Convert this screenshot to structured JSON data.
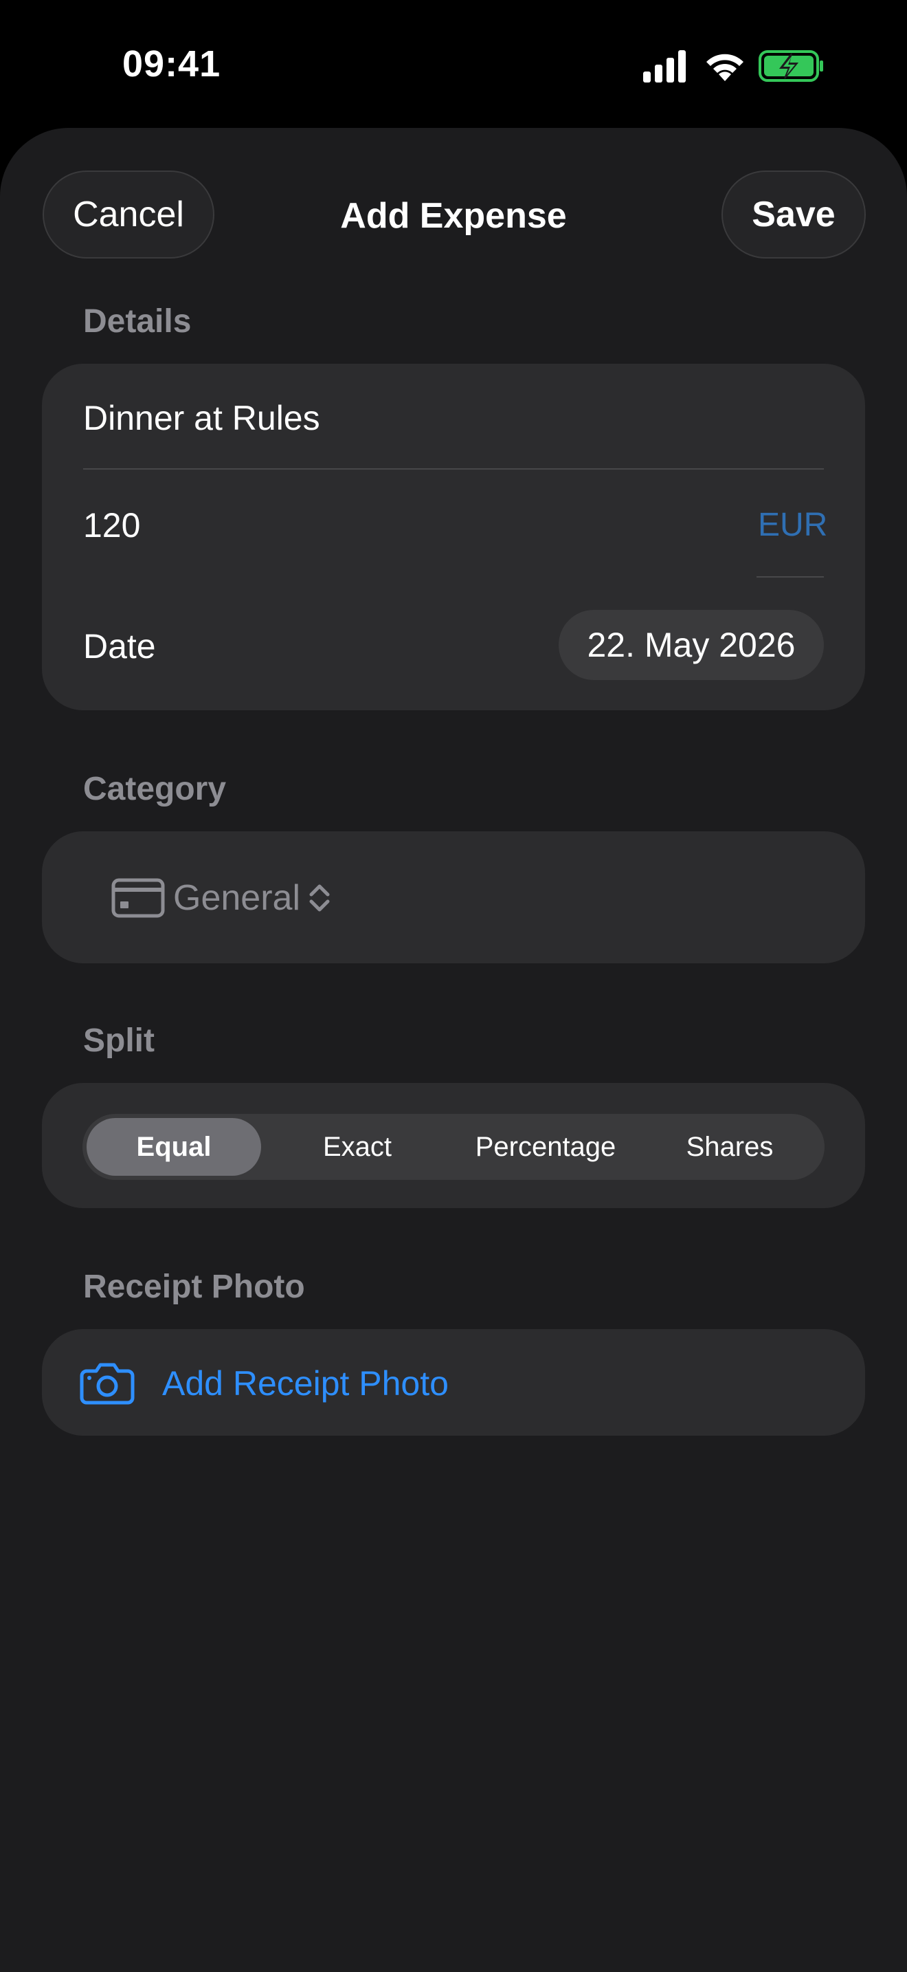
{
  "status_bar": {
    "time": "09:41",
    "icons": [
      "cellular-signal-icon",
      "wifi-icon",
      "battery-charging-icon"
    ]
  },
  "nav": {
    "cancel_label": "Cancel",
    "title": "Add Expense",
    "save_label": "Save"
  },
  "details": {
    "header": "Details",
    "description_value": "Dinner at Rules",
    "amount_value": "120",
    "currency": "EUR",
    "date_label": "Date",
    "date_value": "22. May 2026"
  },
  "category": {
    "header": "Category",
    "selected": "General",
    "icon": "credit-card-icon"
  },
  "split": {
    "header": "Split",
    "options": [
      "Equal",
      "Exact",
      "Percentage",
      "Shares"
    ],
    "selected": "Equal"
  },
  "receipt": {
    "header": "Receipt Photo",
    "action_label": "Add Receipt Photo",
    "icon": "camera-icon"
  },
  "colors": {
    "background": "#000000",
    "sheet": "#1c1c1e",
    "card": "#2c2c2e",
    "accent_blue": "#2e8fff",
    "muted_text": "#8d8d93",
    "battery_green": "#34c759"
  }
}
